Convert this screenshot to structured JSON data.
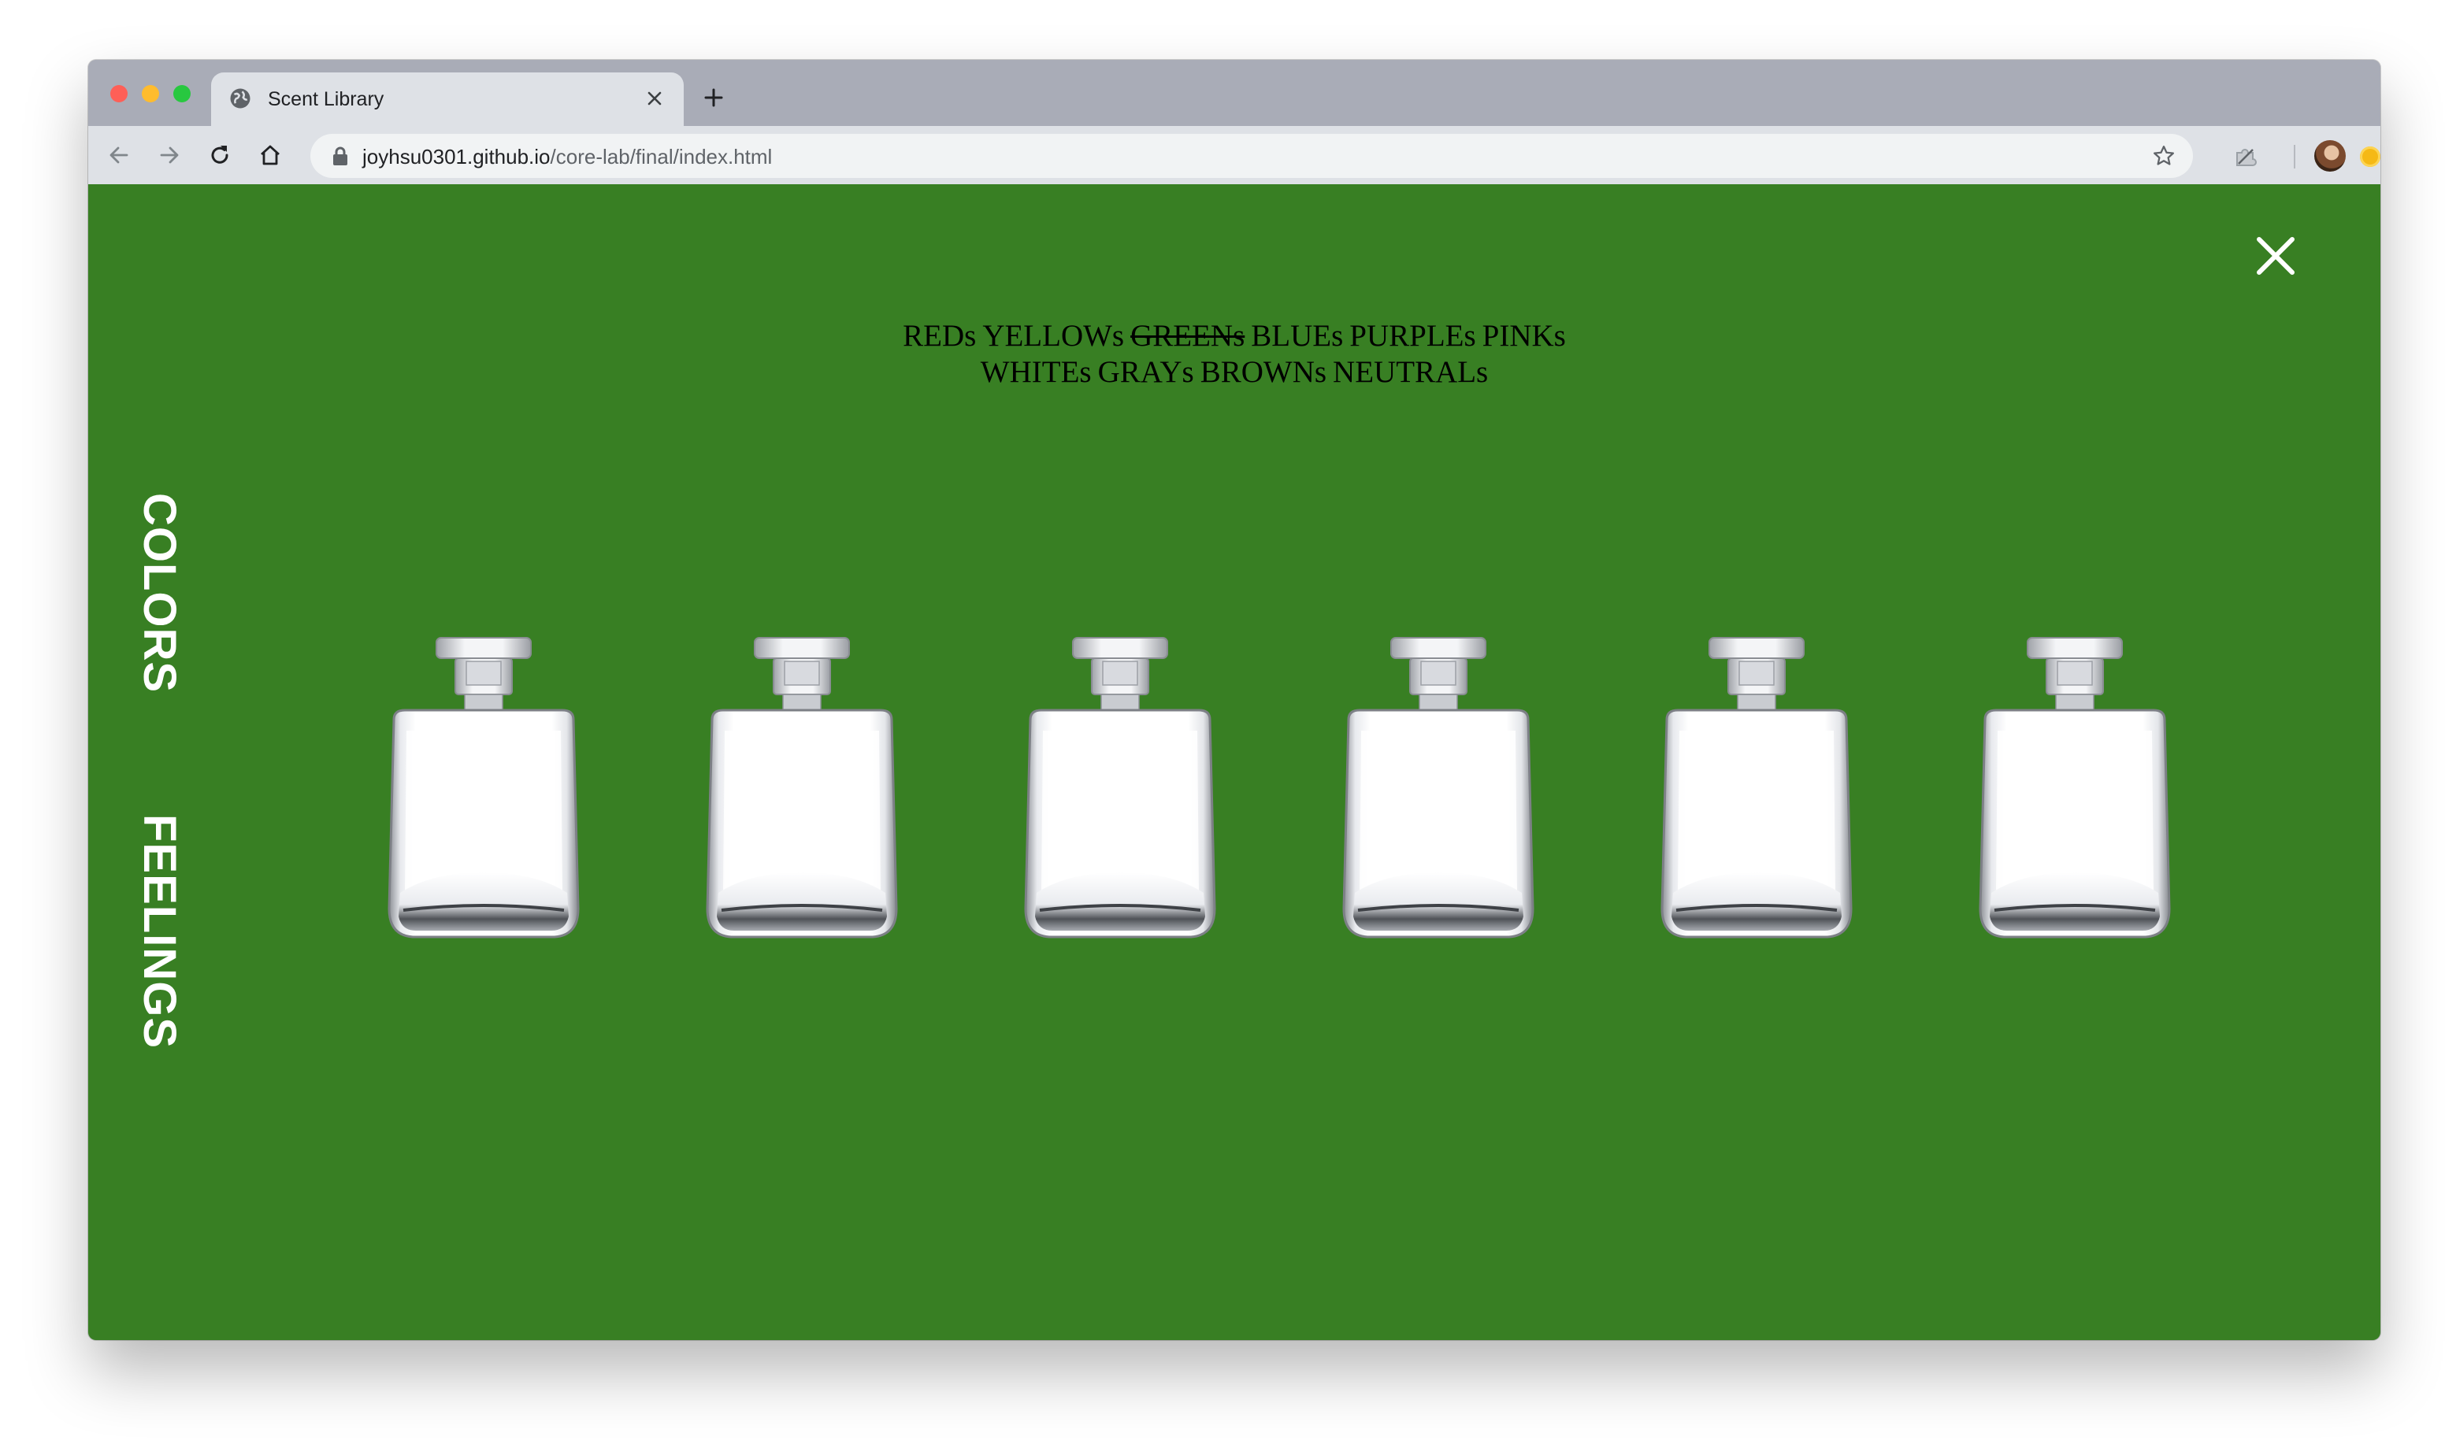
{
  "browser": {
    "tab_title": "Scent Library",
    "url_host": "joyhsu0301.github.io",
    "url_path": "/core-lab/final/index.html"
  },
  "page": {
    "background_color": "#387f23",
    "color_nav": {
      "line1": [
        "REDs",
        "YELLOWs",
        "GREENs",
        "BLUEs",
        "PURPLEs",
        "PINKs"
      ],
      "line2": [
        "WHITEs",
        "GRAYs",
        "BROWNs",
        "NEUTRALs"
      ],
      "active": "GREENs"
    },
    "side_nav": {
      "colors_label": "COLORS",
      "feelings_label": "FEELINGS"
    },
    "bottles": [
      {
        "name": "perfume-bottle-1"
      },
      {
        "name": "perfume-bottle-2"
      },
      {
        "name": "perfume-bottle-3"
      },
      {
        "name": "perfume-bottle-4"
      },
      {
        "name": "perfume-bottle-5"
      },
      {
        "name": "perfume-bottle-6"
      }
    ]
  }
}
